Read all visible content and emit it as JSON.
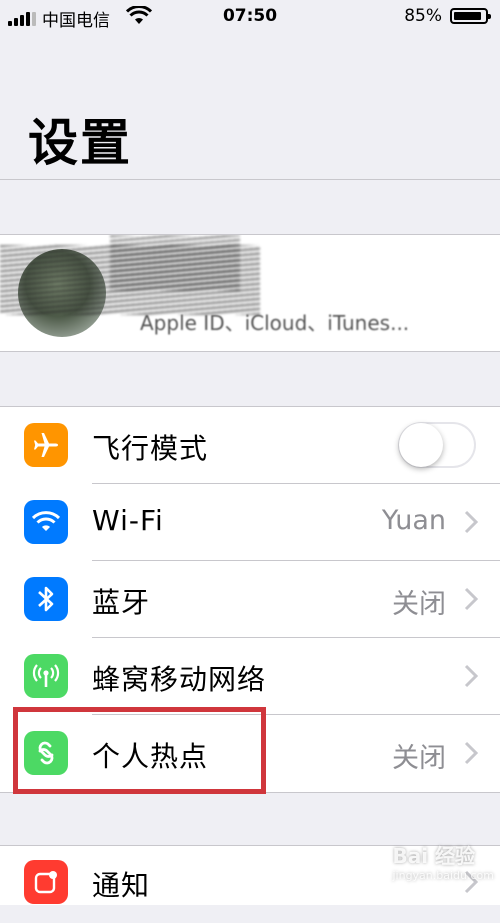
{
  "status_bar": {
    "carrier": "中国电信",
    "time": "07:50",
    "battery": "85%",
    "battery_level": 0.85
  },
  "header": {
    "title": "设置"
  },
  "profile": {
    "subtitle": "Apple ID、iCloud、iTunes..."
  },
  "settings": [
    {
      "label": "飞行模式",
      "icon": "airplane-icon",
      "color": "#ff9500",
      "toggle": false
    },
    {
      "label": "Wi-Fi",
      "value": "Yuan",
      "icon": "wifi-icon",
      "color": "#007aff"
    },
    {
      "label": "蓝牙",
      "value": "关闭",
      "icon": "bluetooth-icon",
      "color": "#007aff"
    },
    {
      "label": "蜂窝移动网络",
      "icon": "cellular-icon",
      "color": "#4cd964"
    },
    {
      "label": "个人热点",
      "value": "关闭",
      "icon": "hotspot-icon",
      "color": "#4cd964"
    }
  ],
  "settings2": [
    {
      "label": "通知",
      "icon": "notifications-icon",
      "color": "#ff3b30"
    }
  ],
  "watermark": {
    "text": "Bai 经验",
    "sub": "jingyan.baidu.com"
  }
}
